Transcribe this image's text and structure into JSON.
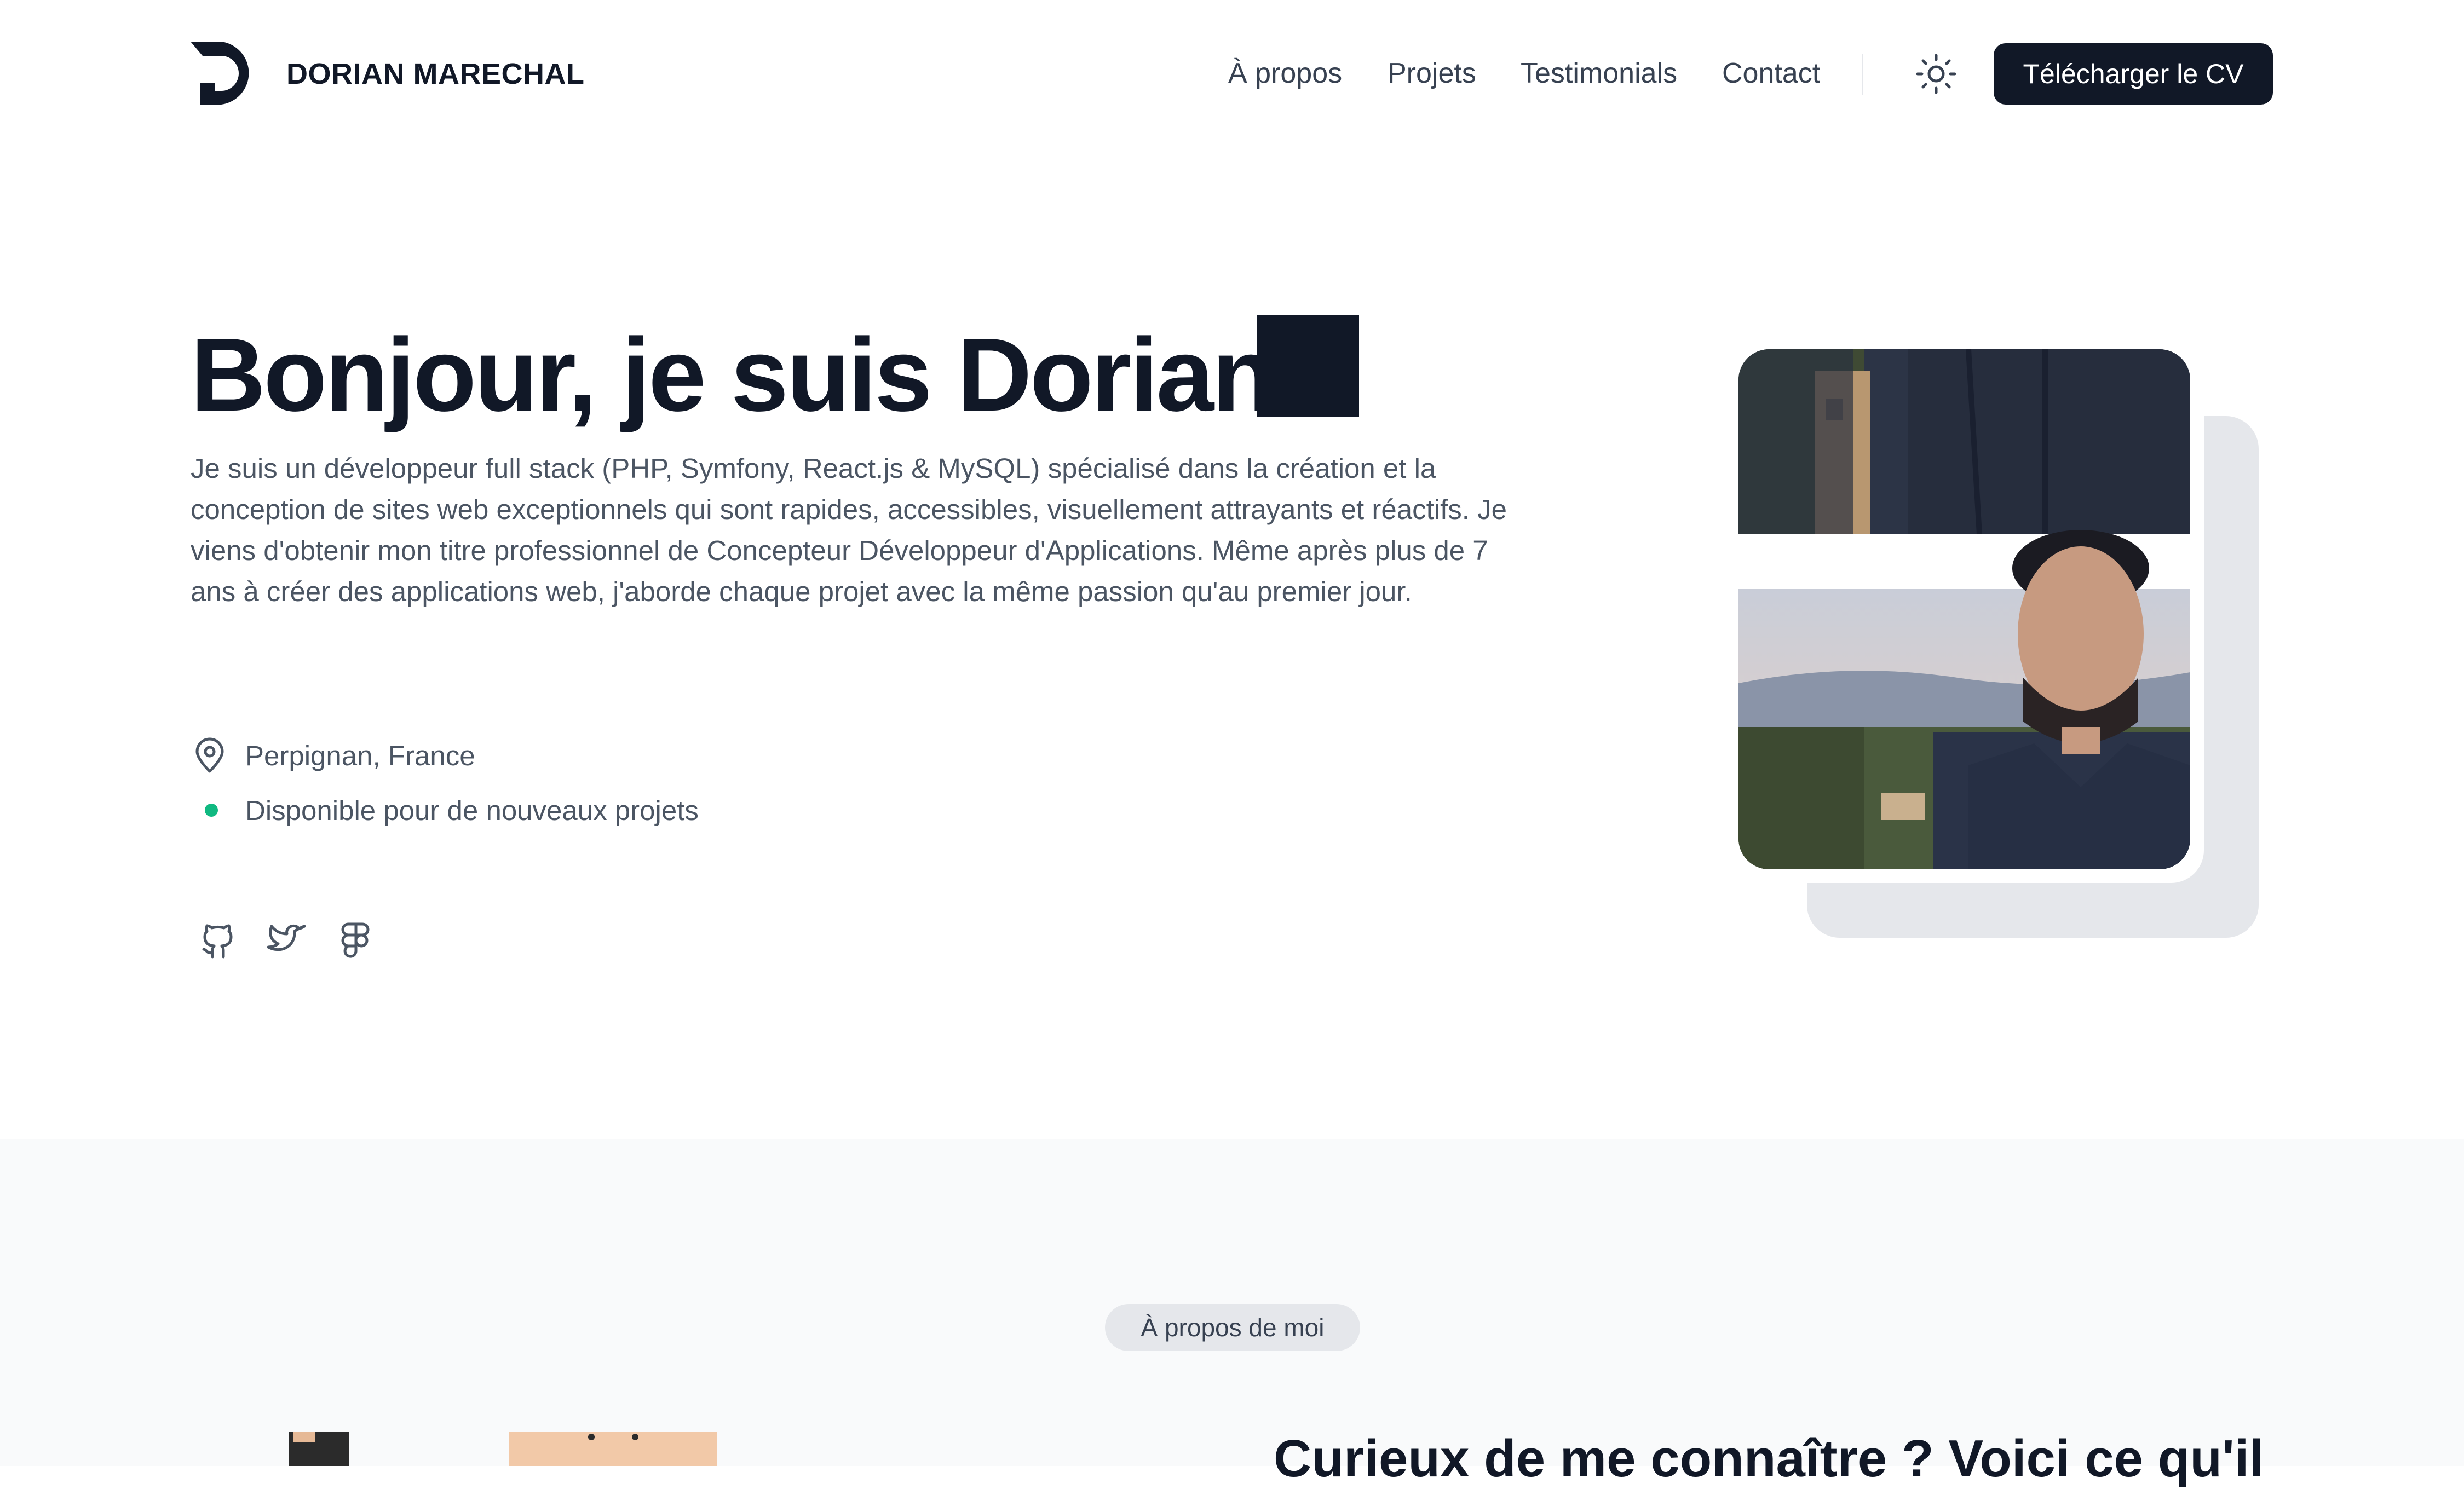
{
  "header": {
    "brand": "DORIAN MARECHAL",
    "nav": [
      "À propos",
      "Projets",
      "Testimonials",
      "Contact"
    ],
    "cv_button": "Télécharger le CV"
  },
  "hero": {
    "title": "Bonjour, je suis Dorian",
    "description": "Je suis un développeur full stack (PHP, Symfony, React.js & MySQL) spécialisé dans la création et la conception de sites web exceptionnels qui sont rapides, accessibles, visuellement attrayants et réactifs. Je viens d'obtenir mon titre professionnel de Concepteur Développeur d'Applications. Même après plus de 7 ans à créer des applications web, j'aborde chaque projet avec la même passion qu'au premier jour.",
    "location": "Perpignan, France",
    "availability": "Disponible pour de nouveaux projets",
    "socials": [
      "github-icon",
      "twitter-icon",
      "figma-icon"
    ]
  },
  "about": {
    "badge": "À propos de moi",
    "heading": "Curieux de me connaître ? Voici ce qu'il"
  },
  "colors": {
    "dark": "#111827",
    "text_muted": "#4b5563",
    "available": "#10b981",
    "section_bg": "#f9fafb",
    "badge_bg": "#e5e7eb"
  }
}
